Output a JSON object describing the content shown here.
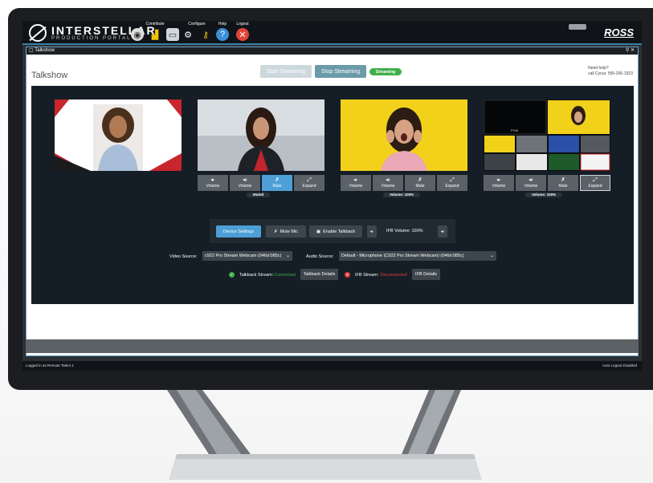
{
  "app": {
    "brand_name": "INTERSTELLAR",
    "brand_sub": "PRODUCTION PORTAL",
    "vendor": "ROSS"
  },
  "nav": {
    "contribute": "Contribute",
    "configure": "Configure",
    "help": "Help",
    "logout": "Logout"
  },
  "window": {
    "title": "Talkshow"
  },
  "page": {
    "title": "Talkshow",
    "start_label": "Start Streaming",
    "stop_label": "Stop Streaming",
    "status_pill": "Streaming",
    "help_line1": "Need help?",
    "help_line2": "call Cyrus: 555-206-1923"
  },
  "tiles": [
    {
      "label": ""
    },
    {
      "buttons": [
        "Volume",
        "Volume",
        "Mute",
        "Expand"
      ],
      "label": "Muted"
    },
    {
      "buttons": [
        "Volume",
        "Volume",
        "Mute",
        "Expand"
      ],
      "label": "Volume: 100%"
    },
    {
      "buttons": [
        "Volume",
        "Volume",
        "Mute",
        "Expand"
      ],
      "label": "Volume: 100%",
      "multiview_label": "PGM"
    }
  ],
  "devices": {
    "settings_label": "Device Settings",
    "mute_mic_label": "Mute Mic",
    "talkback_label": "Enable Talkback",
    "ifb_volume": "IFB Volume: 100%"
  },
  "sources": {
    "video_label": "Video Source:",
    "video_value": "c922 Pro Stream Webcam (046d:085c)",
    "audio_label": "Audio Source:",
    "audio_value": "Default - Microphone (C922 Pro Stream Webcam) (046d:085c)"
  },
  "streams": {
    "talkback_label": "Talkback Stream:",
    "talkback_state": "Connected",
    "talkback_details": "Talkback Details",
    "ifb_label": "IFB Stream:",
    "ifb_state": "Disconnected",
    "ifb_details": "IFB Details"
  },
  "footer": {
    "left": "Logged in as Remote Talent 1",
    "right": "Auto Logout Disabled"
  },
  "colors": {
    "accent_blue": "#4e9fd8",
    "connected_green": "#3fae49",
    "disconnected_red": "#e03b3b",
    "panel_dark": "#151e26"
  }
}
